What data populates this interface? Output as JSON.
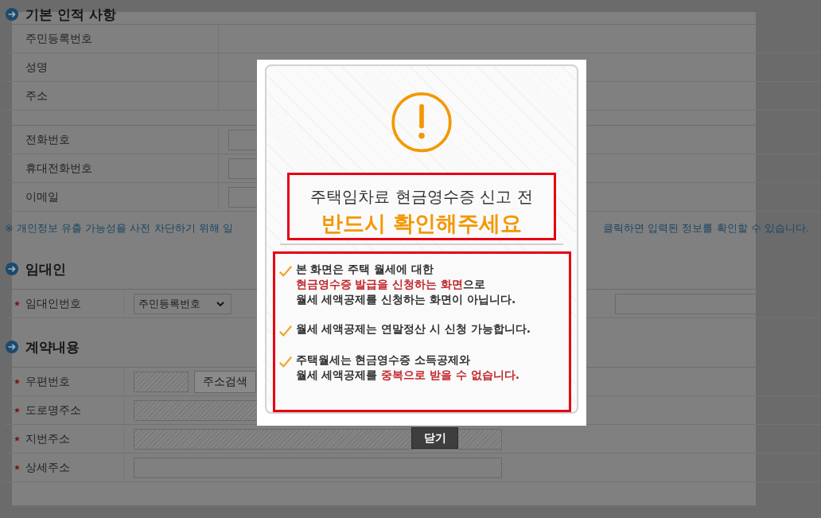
{
  "sections": [
    {
      "title": "기본 인적 사항",
      "tables": [
        {
          "rows": [
            {
              "label": "주민등록번호",
              "required": false,
              "fields": []
            },
            {
              "label": "성명",
              "required": false,
              "fields": []
            },
            {
              "label": "주소",
              "required": false,
              "fields": []
            }
          ]
        },
        {
          "rows": [
            {
              "label": "전화번호",
              "required": false,
              "fields": [
                {
                  "kind": "short-input"
                }
              ]
            },
            {
              "label": "휴대전화번호",
              "required": false,
              "fields": [
                {
                  "kind": "short-input"
                }
              ]
            },
            {
              "label": "이메일",
              "required": false,
              "fields": [
                {
                  "kind": "short-input"
                }
              ]
            }
          ]
        }
      ],
      "notice": [
        "※ 개인정보 유출 가능성을 사전 차단하기 위해 일",
        "클릭하면 입력된 정보를 확인할 수 있습니다."
      ]
    },
    {
      "title": "임대인",
      "tables": [
        {
          "rows": [
            {
              "label": "임대인번호",
              "required": true,
              "fields": [
                {
                  "kind": "select",
                  "value": "주민등록번호"
                },
                {
                  "kind": "side-input"
                }
              ]
            }
          ]
        }
      ]
    },
    {
      "title": "계약내용",
      "tables": [
        {
          "rows": [
            {
              "label": "우편번호",
              "required": true,
              "fields": [
                {
                  "kind": "zip"
                },
                {
                  "kind": "button",
                  "label": "주소검색"
                }
              ]
            },
            {
              "label": "도로명주소",
              "required": true,
              "fields": [
                {
                  "kind": "readonly"
                }
              ]
            },
            {
              "label": "지번주소",
              "required": true,
              "fields": [
                {
                  "kind": "readonly"
                }
              ]
            },
            {
              "label": "상세주소",
              "required": true,
              "fields": [
                {
                  "kind": "input"
                }
              ]
            }
          ]
        }
      ]
    }
  ],
  "modal": {
    "heading": "주택임차료 현금영수증 신고 전",
    "emphasis": "반드시 확인해주세요",
    "items": [
      {
        "lines": [
          [
            {
              "text": "본 화면은 주택 월세에 대한",
              "highlight": false
            }
          ],
          [
            {
              "text": "현금영수증 발급을 신청하는 화면",
              "highlight": true
            },
            {
              "text": "으로",
              "highlight": false
            }
          ],
          [
            {
              "text": "월세 세액공제를 신청하는 화면이 아닙니다.",
              "highlight": false
            }
          ]
        ]
      },
      {
        "lines": [
          [
            {
              "text": "월세 세액공제는 연말정산 시 신청 가능합니다.",
              "highlight": false
            }
          ]
        ]
      },
      {
        "lines": [
          [
            {
              "text": "주택월세는 현금영수증 소득공제와",
              "highlight": false
            }
          ],
          [
            {
              "text": "월세 세액공제를 ",
              "highlight": false
            },
            {
              "text": "중복으로 받을 수 없습니다.",
              "highlight": true
            }
          ]
        ]
      }
    ],
    "close": "닫기"
  }
}
